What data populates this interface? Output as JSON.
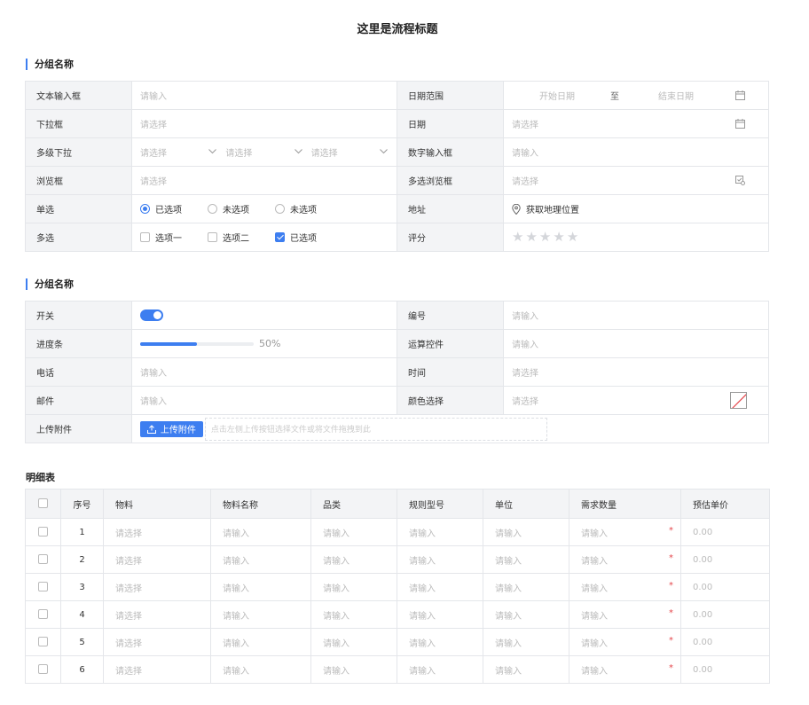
{
  "page": {
    "title": "这里是流程标题"
  },
  "section1": {
    "title": "分组名称",
    "text_input": {
      "label": "文本输入框",
      "placeholder": "请输入"
    },
    "date_range": {
      "label": "日期范围",
      "start": "开始日期",
      "sep": "至",
      "end": "结束日期"
    },
    "dropdown": {
      "label": "下拉框",
      "placeholder": "请选择"
    },
    "date": {
      "label": "日期",
      "placeholder": "请选择"
    },
    "cascade": {
      "label": "多级下拉",
      "placeholders": [
        "请选择",
        "请选择",
        "请选择"
      ]
    },
    "number": {
      "label": "数字输入框",
      "placeholder": "请输入"
    },
    "browse": {
      "label": "浏览框",
      "placeholder": "请选择"
    },
    "multi_browse": {
      "label": "多选浏览框",
      "placeholder": "请选择"
    },
    "radio": {
      "label": "单选",
      "options": [
        "已选项",
        "未选项",
        "未选项"
      ],
      "selected": 0
    },
    "address": {
      "label": "地址",
      "value": "获取地理位置"
    },
    "checkbox": {
      "label": "多选",
      "options": [
        "选项一",
        "选项二",
        "已选项"
      ],
      "checked": [
        2
      ]
    },
    "rating": {
      "label": "评分",
      "max": 5,
      "value": 0
    }
  },
  "section2": {
    "title": "分组名称",
    "switch": {
      "label": "开关",
      "on": true
    },
    "serial": {
      "label": "编号",
      "placeholder": "请输入"
    },
    "progress": {
      "label": "进度条",
      "value": 0.5,
      "text": "50%"
    },
    "calc": {
      "label": "运算控件",
      "placeholder": "请输入"
    },
    "phone": {
      "label": "电话",
      "placeholder": "请输入"
    },
    "time": {
      "label": "时间",
      "placeholder": "请选择"
    },
    "email": {
      "label": "邮件",
      "placeholder": "请输入"
    },
    "color": {
      "label": "颜色选择",
      "placeholder": "请选择"
    },
    "upload": {
      "label": "上传附件",
      "button": "上传附件",
      "hint": "点击左侧上传按钮选择文件或将文件拖拽到此"
    }
  },
  "detail": {
    "title": "明细表",
    "headers": [
      "序号",
      "物料",
      "物料名称",
      "品类",
      "规则型号",
      "单位",
      "需求数量",
      "预估单价"
    ],
    "rows": [
      {
        "seq": "1",
        "material": "请选择",
        "name": "请输入",
        "category": "请输入",
        "model": "请输入",
        "unit": "请输入",
        "qty": "请输入",
        "price": "0.00"
      },
      {
        "seq": "2",
        "material": "请选择",
        "name": "请输入",
        "category": "请输入",
        "model": "请输入",
        "unit": "请输入",
        "qty": "请输入",
        "price": "0.00"
      },
      {
        "seq": "3",
        "material": "请选择",
        "name": "请输入",
        "category": "请输入",
        "model": "请输入",
        "unit": "请输入",
        "qty": "请输入",
        "price": "0.00"
      },
      {
        "seq": "4",
        "material": "请选择",
        "name": "请输入",
        "category": "请输入",
        "model": "请输入",
        "unit": "请输入",
        "qty": "请输入",
        "price": "0.00"
      },
      {
        "seq": "5",
        "material": "请选择",
        "name": "请输入",
        "category": "请输入",
        "model": "请输入",
        "unit": "请输入",
        "qty": "请输入",
        "price": "0.00"
      },
      {
        "seq": "6",
        "material": "请选择",
        "name": "请输入",
        "category": "请输入",
        "model": "请输入",
        "unit": "请输入",
        "qty": "请输入",
        "price": "0.00"
      }
    ],
    "required_mark": "*"
  },
  "colors": {
    "accent": "#3d7ef0",
    "required": "#e5484d",
    "label_bg": "#f3f4f6",
    "border": "#e4e6ea"
  },
  "icons": {
    "date": "calendar-icon",
    "browse": "browse-icon",
    "address": "location-pin-icon",
    "upload": "upload-icon",
    "cascade": "chevron-down-icon",
    "rating": "star-icon"
  }
}
